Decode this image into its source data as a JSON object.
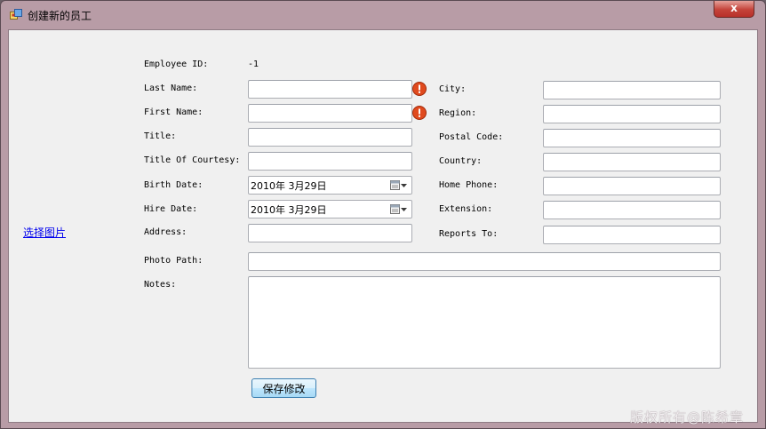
{
  "window": {
    "title": "创建新的员工",
    "close_label": "x"
  },
  "form": {
    "employee_id_label": "Employee ID:",
    "employee_id_value": "-1",
    "last_name_label": "Last Name:",
    "first_name_label": "First Name:",
    "title_label": "Title:",
    "title_of_courtesy_label": "Title Of Courtesy:",
    "birth_date_label": "Birth Date:",
    "birth_date_value": "2010年  3月29日",
    "hire_date_label": "Hire Date:",
    "hire_date_value": "2010年  3月29日",
    "address_label": "Address:",
    "city_label": "City:",
    "region_label": "Region:",
    "postal_code_label": "Postal Code:",
    "country_label": "Country:",
    "home_phone_label": "Home Phone:",
    "extension_label": "Extension:",
    "reports_to_label": "Reports To:",
    "photo_path_label": "Photo Path:",
    "notes_label": "Notes:"
  },
  "photo": {
    "select_link": "选择图片"
  },
  "actions": {
    "save_label": "保存修改"
  },
  "watermark": {
    "text": "版权所有@陈希章"
  },
  "colors": {
    "titlebar": "#b89ca6",
    "client_bg": "#f0f0f0",
    "error_icon": "#e04a1e",
    "link": "#0000ee"
  }
}
